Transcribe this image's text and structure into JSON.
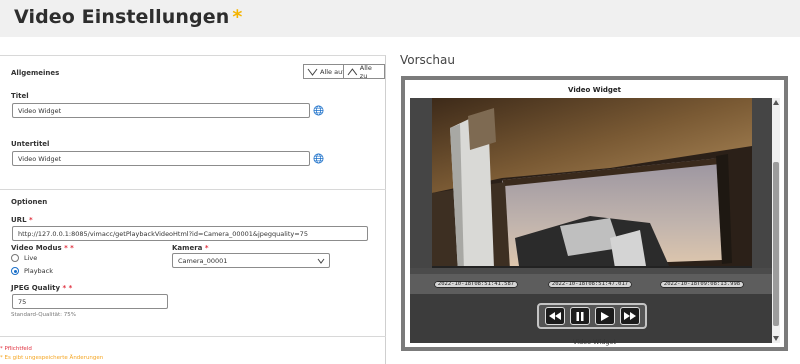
{
  "page": {
    "title": "Video Einstellungen",
    "unsaved_marker": "*"
  },
  "general": {
    "heading": "Allgemeines",
    "expand_all": "Alle auf",
    "collapse_all": "Alle zu",
    "title_label": "Titel",
    "title_value": "Video Widget",
    "subtitle_label": "Untertitel",
    "subtitle_value": "Video Widget"
  },
  "options": {
    "heading": "Optionen",
    "url_label": "URL",
    "url_value": "http://127.0.0.1:8085/vimacc/getPlaybackVideoHtml?id=Camera_00001&jpegquality=75",
    "mode_label": "Video Modus",
    "mode_options": [
      "Live",
      "Playback"
    ],
    "mode_selected": "Playback",
    "camera_label": "Kamera",
    "camera_value": "Camera_00001",
    "jpeg_label": "JPEG Quality",
    "jpeg_value": "75",
    "jpeg_hint": "Standard-Qualität: 75%"
  },
  "footer": {
    "required_note": "* Pflichtfeld",
    "unsaved_note": "* Es gibt ungespeicherte Änderungen"
  },
  "preview": {
    "heading": "Vorschau",
    "widget_title": "Video Widget",
    "widget_subtitle": "Video Widget",
    "timestamps": {
      "start": "2022-10-18T08:51:41.587",
      "current": "2022-10-18T08:51:47.017",
      "end": "2022-10-18T09:08:13.998"
    },
    "controls": [
      "rewind-icon",
      "pause-icon",
      "play-icon",
      "fast-forward-icon"
    ]
  },
  "colors": {
    "required": "#e0313f",
    "unsaved": "#f5a623",
    "accent": "#1a6fc9",
    "title_star": "#f5b400"
  }
}
